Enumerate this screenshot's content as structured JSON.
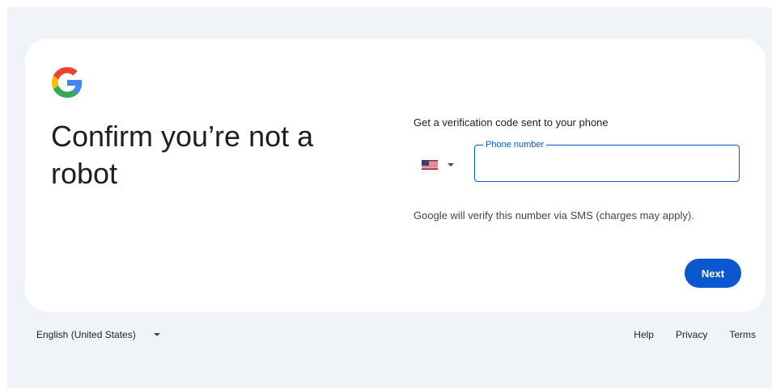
{
  "card": {
    "title": "Confirm you’re not a robot",
    "subtitle": "Get a verification code sent to your phone",
    "country_selector": {
      "flag": "US",
      "icon": "chevron-down-icon"
    },
    "phone_field": {
      "label": "Phone number",
      "value": ""
    },
    "helper_text": "Google will verify this number via SMS (charges may apply).",
    "next_label": "Next"
  },
  "footer": {
    "language": "English (United States)",
    "links": [
      "Help",
      "Privacy",
      "Terms"
    ]
  },
  "colors": {
    "background": "#f0f4f9",
    "accent": "#0b57d0",
    "text": "#1f1f1f"
  }
}
